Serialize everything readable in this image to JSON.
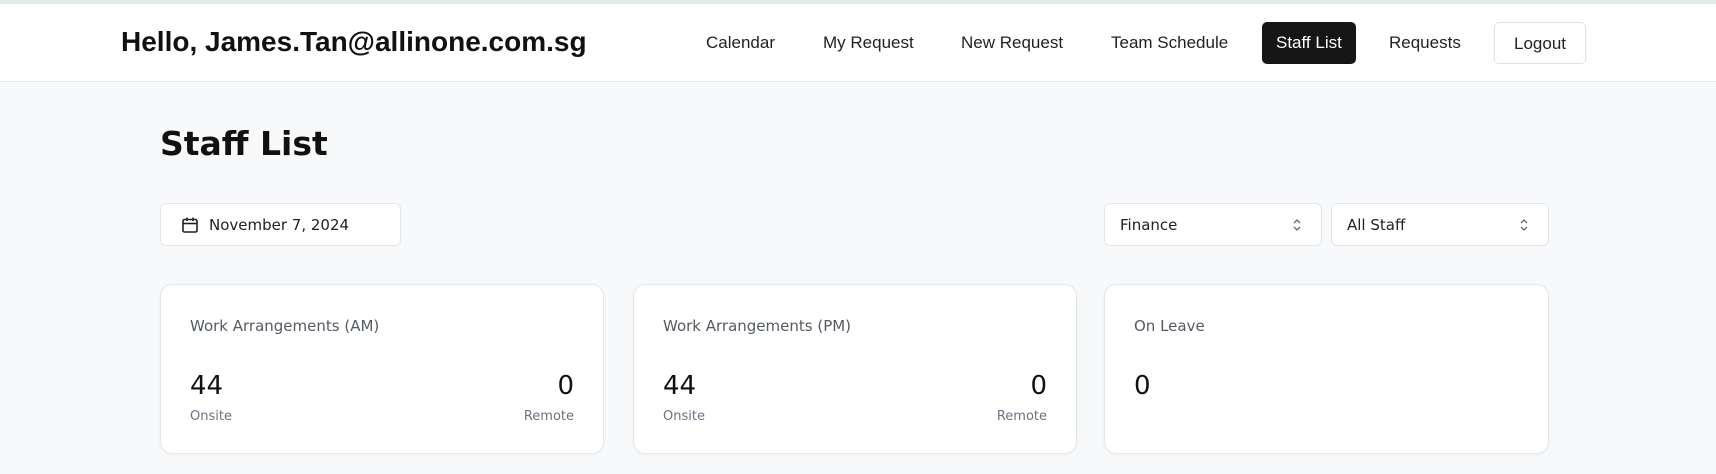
{
  "header": {
    "greeting": "Hello, James.Tan@allinone.com.sg",
    "nav": [
      {
        "label": "Calendar"
      },
      {
        "label": "My Request"
      },
      {
        "label": "New Request"
      },
      {
        "label": "Team Schedule"
      },
      {
        "label": "Staff List",
        "active": true
      },
      {
        "label": "Requests"
      },
      {
        "label": "Logout"
      }
    ]
  },
  "page": {
    "title": "Staff List"
  },
  "filters": {
    "date": "November 7, 2024",
    "department": "Finance",
    "staff_scope": "All Staff"
  },
  "cards": [
    {
      "title": "Work Arrangements (AM)",
      "onsite_value": "44",
      "onsite_label": "Onsite",
      "remote_value": "0",
      "remote_label": "Remote"
    },
    {
      "title": "Work Arrangements (PM)",
      "onsite_value": "44",
      "onsite_label": "Onsite",
      "remote_value": "0",
      "remote_label": "Remote"
    },
    {
      "title": "On Leave",
      "value": "0"
    }
  ],
  "icons": {
    "date": "calendar-icon",
    "select": "chevron-up-down-icon"
  },
  "colors": {
    "active_nav_bg": "#161616",
    "page_bg": "#f8f9fa"
  }
}
